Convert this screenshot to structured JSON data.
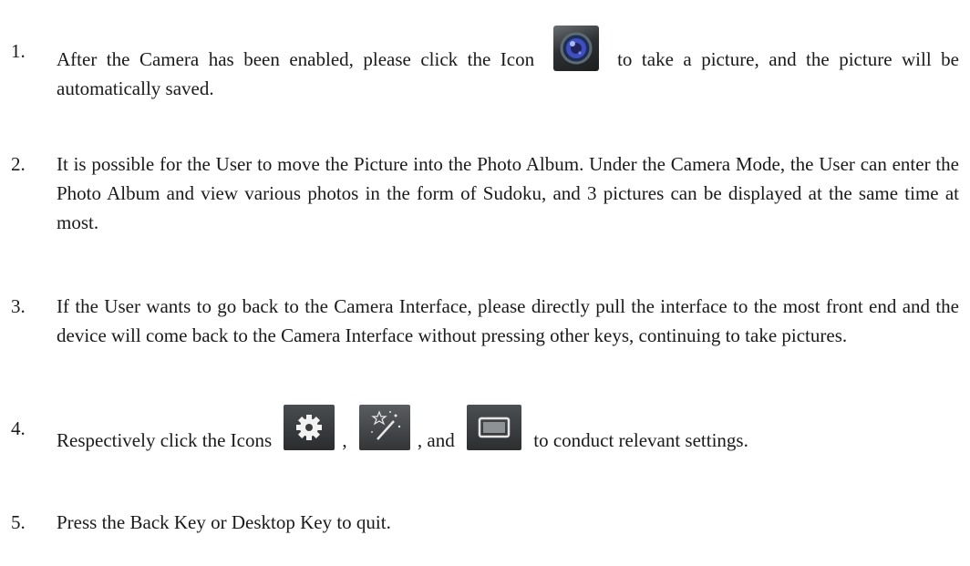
{
  "items": [
    {
      "number": "1.",
      "text_a": "After the Camera has been enabled, please click the Icon",
      "text_b": "to take a picture, and the picture will be automatically saved.",
      "icon": "camera-lens-icon"
    },
    {
      "number": "2.",
      "text": "It is possible for the User to move the Picture into the Photo Album. Under the Camera Mode, the User can enter the Photo Album and view various photos in the form of Sudoku, and 3 pictures can be displayed at the same time at most."
    },
    {
      "number": "3.",
      "text": "If the User wants to go back to the Camera Interface, please directly pull the interface to the most front end and the device will come back to the Camera Interface without pressing other keys, continuing to take pictures."
    },
    {
      "number": "4.",
      "text_a": "Respectively click the Icons",
      "sep_1": ",",
      "sep_2": ", and",
      "text_b": "to conduct relevant settings.",
      "icons": [
        "settings-gear-icon",
        "magic-wand-icon",
        "frame-icon"
      ]
    },
    {
      "number": "5.",
      "text": "Press the Back Key or Desktop Key to quit."
    }
  ]
}
